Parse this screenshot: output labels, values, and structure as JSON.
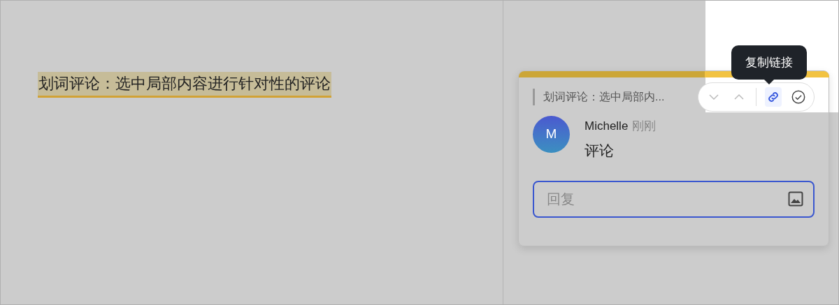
{
  "document": {
    "highlighted_text": "划词评论：选中局部内容进行针对性的评论"
  },
  "comment_card": {
    "quote": "划词评论：选中局部内...",
    "toolbar": [
      {
        "kind": "next",
        "active": false
      },
      {
        "kind": "previous",
        "active": false
      },
      {
        "kind": "copy-link",
        "active": true
      },
      {
        "kind": "resolve",
        "active": false
      }
    ],
    "tooltip": "复制链接",
    "comments": [
      {
        "avatar": "M",
        "author": "Michelle",
        "time": "刚刚",
        "text": "评论"
      }
    ],
    "reply": {
      "placeholder": "回复"
    }
  }
}
